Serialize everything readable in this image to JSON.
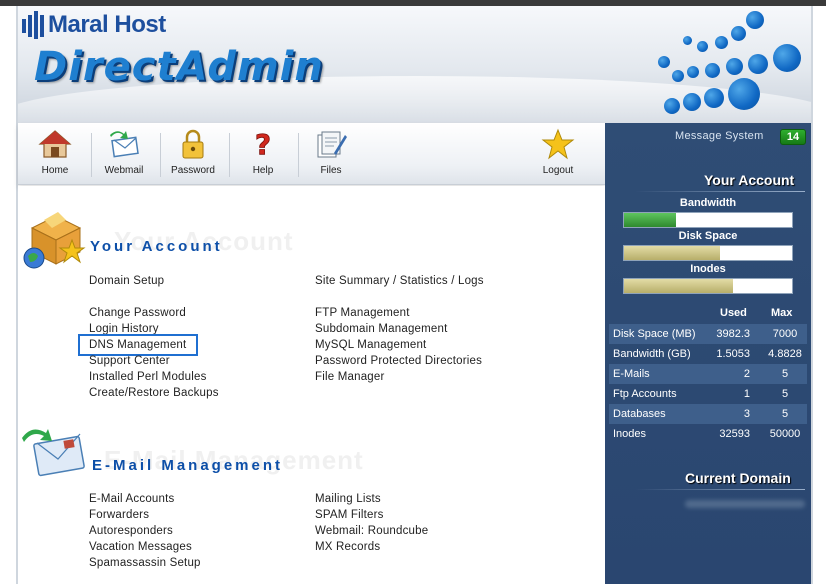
{
  "brand": "Maral Host",
  "app_title": "DirectAdmin",
  "colors": {
    "accent": "#1f7fd0",
    "sidebar_bg": "#2f4d75",
    "badge": "#1f9a1f",
    "highlight": "#1f6fd1",
    "bandwidth_fill": "#3a9a3a",
    "disk_fill": "#c9c28a"
  },
  "toolbar": {
    "items": [
      {
        "label": "Home",
        "icon": "home-icon"
      },
      {
        "label": "Webmail",
        "icon": "webmail-icon"
      },
      {
        "label": "Password",
        "icon": "lock-icon"
      },
      {
        "label": "Help",
        "icon": "help-icon"
      },
      {
        "label": "Files",
        "icon": "files-icon"
      },
      {
        "label": "Logout",
        "icon": "star-icon"
      }
    ]
  },
  "sidebar": {
    "message_label": "Message System",
    "message_count": "14",
    "your_account_title": "Your Account",
    "meters": [
      {
        "label": "Bandwidth",
        "fill_fraction": 0.31
      },
      {
        "label": "Disk Space",
        "fill_fraction": 0.57
      },
      {
        "label": "Inodes",
        "fill_fraction": 0.65
      }
    ],
    "stats_headers": {
      "used": "Used",
      "max": "Max"
    },
    "stats": [
      {
        "name": "Disk Space (MB)",
        "used": "3982.3",
        "max": "7000"
      },
      {
        "name": "Bandwidth (GB)",
        "used": "1.5053",
        "max": "4.8828"
      },
      {
        "name": "E-Mails",
        "used": "2",
        "max": "5"
      },
      {
        "name": "Ftp Accounts",
        "used": "1",
        "max": "5"
      },
      {
        "name": "Databases",
        "used": "3",
        "max": "5"
      },
      {
        "name": "Inodes",
        "used": "32593",
        "max": "50000"
      }
    ],
    "current_domain_title": "Current Domain"
  },
  "main": {
    "your_account": {
      "title": "Your Account",
      "left_links": [
        "Domain Setup",
        "Change Password",
        "Login History",
        "DNS Management",
        "Support Center",
        "Installed Perl Modules",
        "Create/Restore Backups"
      ],
      "right_links": [
        "Site Summary / Statistics / Logs",
        "FTP Management",
        "Subdomain Management",
        "MySQL Management",
        "Password Protected Directories",
        "File Manager"
      ]
    },
    "email": {
      "title": "E-Mail Management",
      "left_links": [
        "E-Mail Accounts",
        "Forwarders",
        "Autoresponders",
        "Vacation Messages",
        "Spamassassin Setup"
      ],
      "right_links": [
        "Mailing Lists",
        "SPAM Filters",
        "Webmail: Roundcube",
        "MX Records"
      ]
    }
  }
}
